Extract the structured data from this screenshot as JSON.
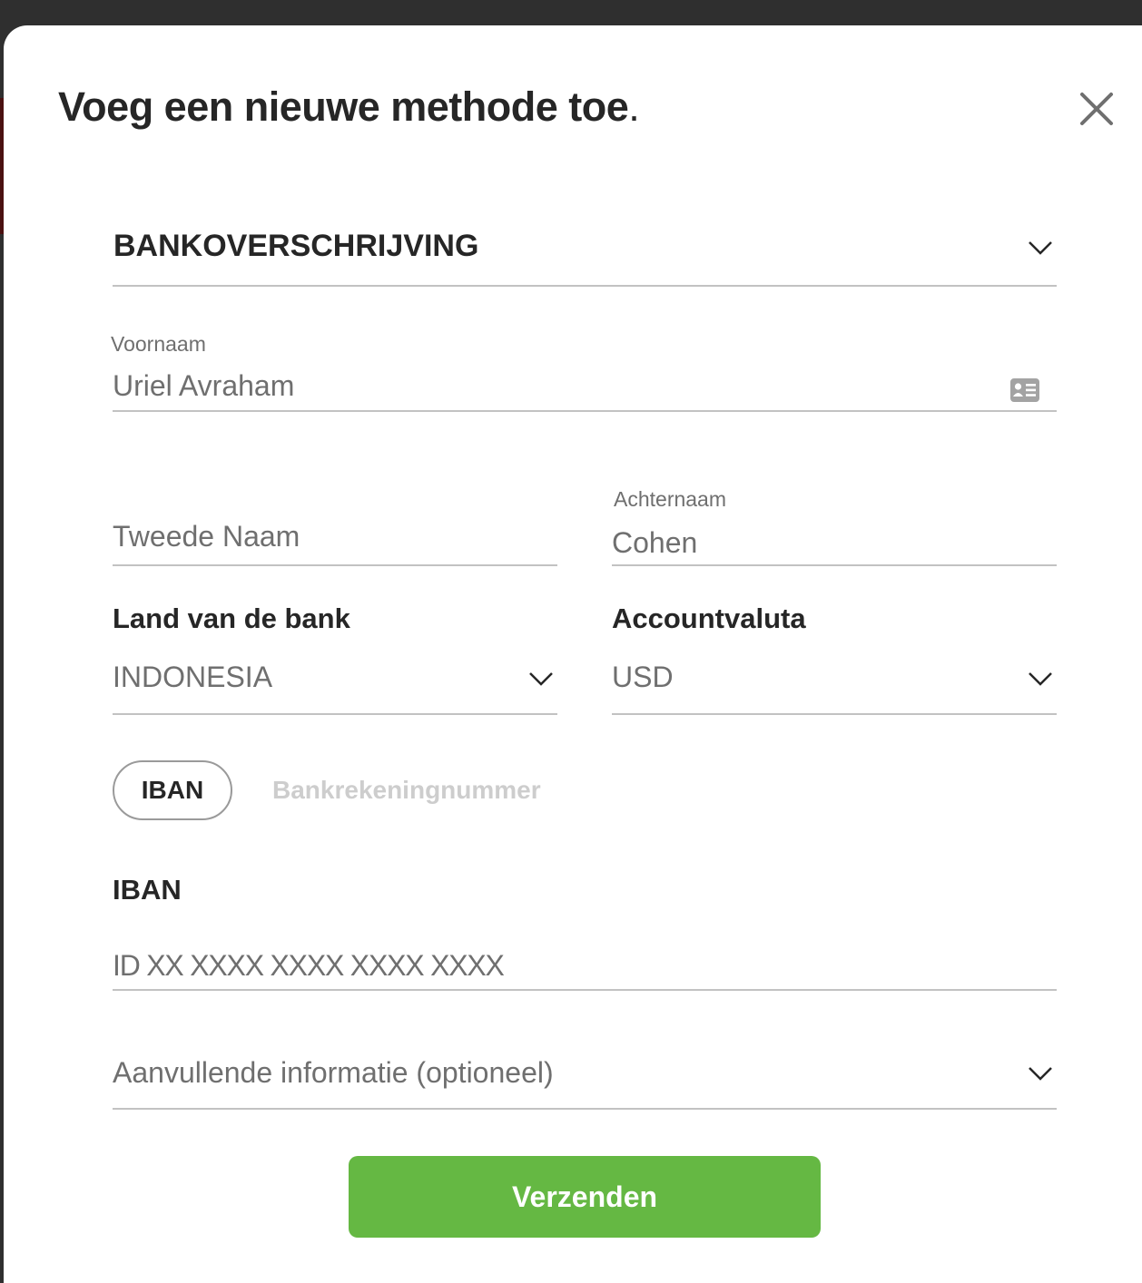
{
  "modal": {
    "title": "Voeg een nieuwe methode toe",
    "title_dot": "."
  },
  "method_select": {
    "value": "BANKOVERSCHRIJVING"
  },
  "first_name": {
    "label": "Voornaam",
    "value": "Uriel Avraham"
  },
  "middle_name": {
    "placeholder": "Tweede Naam"
  },
  "last_name": {
    "label": "Achternaam",
    "value": "Cohen"
  },
  "bank_country": {
    "label": "Land van de bank",
    "value": "INDONESIA"
  },
  "account_currency": {
    "label": "Accountvaluta",
    "value": "USD"
  },
  "account_type_tabs": {
    "active": "IBAN",
    "inactive": "Bankrekeningnummer"
  },
  "iban": {
    "label": "IBAN",
    "placeholder": "ID XX XXXX XXXX XXXX XXXX"
  },
  "additional_info": {
    "label": "Aanvullende informatie (optioneel)"
  },
  "submit": {
    "label": "Verzenden"
  },
  "colors": {
    "accent": "#65b843",
    "text": "#262626",
    "muted": "#6f6f6f",
    "line": "#c2c2c2"
  },
  "icons": {
    "close": "close-icon",
    "dropdown": "chevron-down-icon",
    "id_card": "id-card-icon"
  }
}
